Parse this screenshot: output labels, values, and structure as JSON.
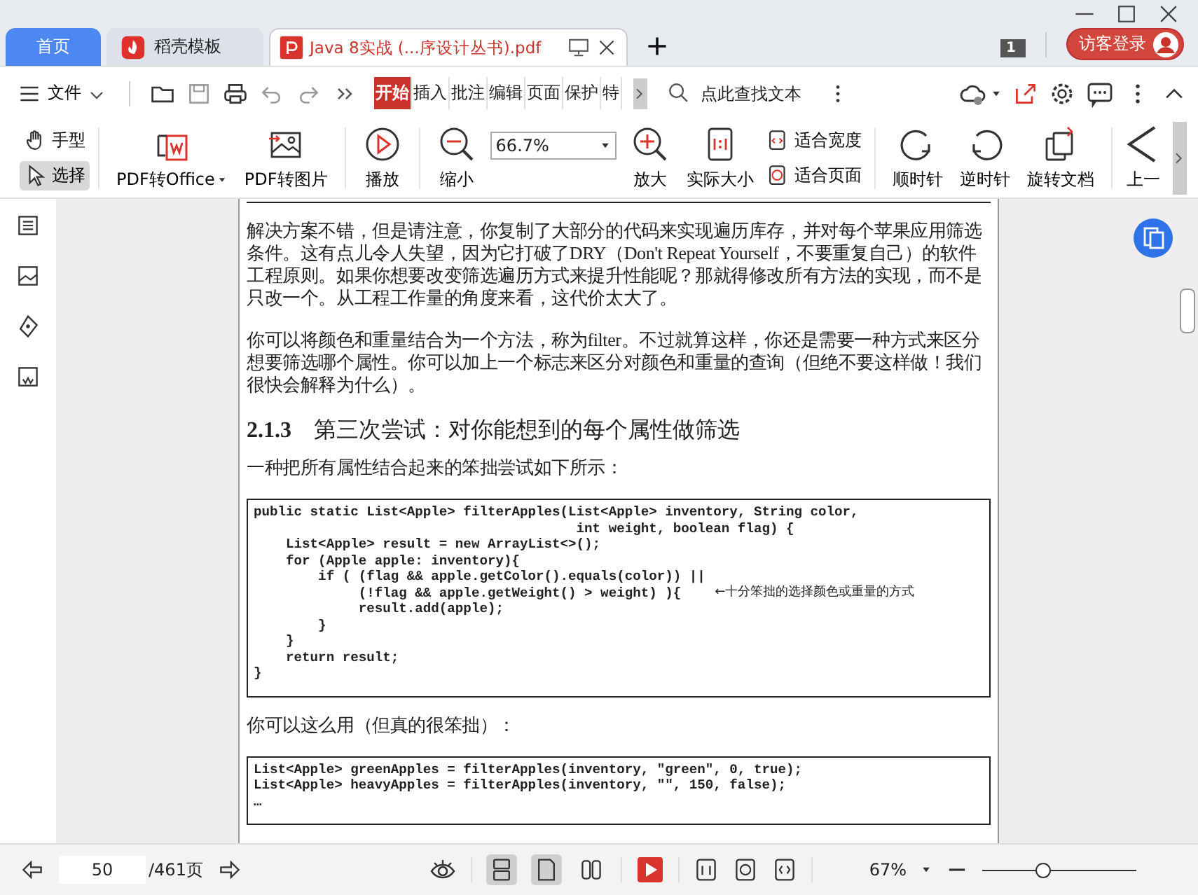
{
  "tabs": [
    {
      "kind": "home",
      "label": "首页",
      "selected": false
    },
    {
      "kind": "app",
      "label": "稻壳模板",
      "selected": false
    },
    {
      "kind": "doc",
      "label": "Java 8实战 (...序设计丛书).pdf",
      "selected": true
    }
  ],
  "window_count": "1",
  "login_button": "访客登录",
  "menu": {
    "file": "文件",
    "tabs": [
      {
        "label": "开始",
        "selected": true
      },
      {
        "label": "插入",
        "selected": false
      },
      {
        "label": "批注",
        "selected": false
      },
      {
        "label": "编辑",
        "selected": false
      },
      {
        "label": "页面",
        "selected": false
      },
      {
        "label": "保护",
        "selected": false
      },
      {
        "label": "特",
        "selected": false
      }
    ],
    "search_placeholder": "点此查找文本"
  },
  "ribbon": [
    {
      "kind": "pair",
      "items": [
        {
          "label": "手型",
          "selected": false
        },
        {
          "label": "选择",
          "selected": true
        }
      ]
    },
    {
      "kind": "large",
      "label": "PDF转Office",
      "dropdown": true
    },
    {
      "kind": "large",
      "label": "PDF转图片",
      "dropdown": false
    },
    {
      "kind": "large",
      "label": "播放",
      "dropdown": false
    },
    {
      "kind": "large",
      "label": "缩小",
      "dropdown": false
    },
    {
      "kind": "zoom",
      "value": "66.7%"
    },
    {
      "kind": "large",
      "label": "放大",
      "dropdown": false
    },
    {
      "kind": "large",
      "label": "实际大小",
      "dropdown": false
    },
    {
      "kind": "pair",
      "items": [
        {
          "label": "适合宽度",
          "selected": false
        },
        {
          "label": "适合页面",
          "selected": false
        }
      ]
    },
    {
      "kind": "large",
      "label": "顺时针",
      "dropdown": false
    },
    {
      "kind": "large",
      "label": "逆时针",
      "dropdown": false
    },
    {
      "kind": "large",
      "label": "旋转文档",
      "dropdown": false
    },
    {
      "kind": "large",
      "label": "上一",
      "dropdown": false
    }
  ],
  "document": [
    {
      "kind": "paragraph",
      "text": "解决方案不错，但是请注意，你复制了大部分的代码来实现遍历库存，并对每个苹果应用筛选条件。这有点儿令人失望，因为它打破了DRY（Don't Repeat Yourself，不要重复自己）的软件工程原则。如果你想要改变筛选遍历方式来提升性能呢？那就得修改所有方法的实现，而不是只改一个。从工程工作量的角度来看，这代价太大了。"
    },
    {
      "kind": "paragraph",
      "text": "你可以将颜色和重量结合为一个方法，称为filter。不过就算这样，你还是需要一种方式来区分想要筛选哪个属性。你可以加上一个标志来区分对颜色和重量的查询（但绝不要这样做！我们很快会解释为什么）。"
    },
    {
      "kind": "heading",
      "number": "2.1.3",
      "title": "第三次尝试：对你能想到的每个属性做筛选"
    },
    {
      "kind": "paragraph",
      "text": "一种把所有属性结合起来的笨拙尝试如下所示："
    },
    {
      "kind": "code",
      "lines": [
        {
          "text": "public static List<Apple> filterApples(List<Apple> inventory, String color,"
        },
        {
          "text": "                                        int weight, boolean flag) {"
        },
        {
          "text": "    List<Apple> result = new ArrayList<>();"
        },
        {
          "text": "    for (Apple apple: inventory){"
        },
        {
          "text": "        if ( (flag && apple.getColor().equals(color)) ||"
        },
        {
          "text": "             (!flag && apple.getWeight() > weight) ){",
          "note": "←十分笨拙的选择颜色或重量的方式"
        },
        {
          "text": "             result.add(apple);"
        },
        {
          "text": "        }"
        },
        {
          "text": "    }"
        },
        {
          "text": "    return result;"
        },
        {
          "text": "}"
        }
      ]
    },
    {
      "kind": "paragraph",
      "text": "你可以这么用（但真的很笨拙）："
    },
    {
      "kind": "code",
      "lines": [
        {
          "text": "List<Apple> greenApples = filterApples(inventory, \"green\", 0, true);"
        },
        {
          "text": "List<Apple> heavyApples = filterApples(inventory, \"\", 150, false);"
        },
        {
          "text": "…"
        }
      ]
    }
  ],
  "status": {
    "page": "50",
    "total": "/461页",
    "views": [
      {
        "selected": true
      },
      {
        "selected": true
      },
      {
        "selected": false
      }
    ],
    "zoom": "67%",
    "level": 0.4
  }
}
